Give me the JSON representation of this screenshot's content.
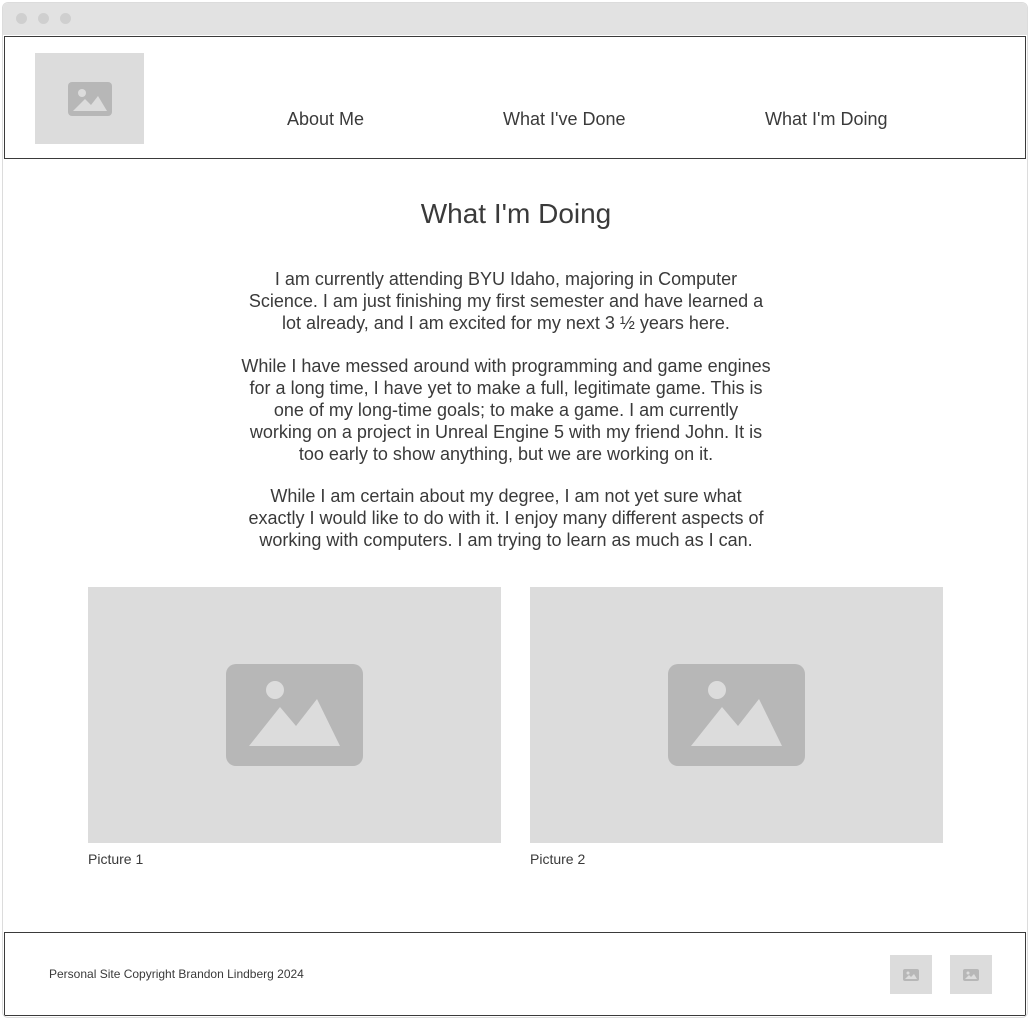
{
  "nav": {
    "items": [
      {
        "label": "About Me"
      },
      {
        "label": "What I've Done"
      },
      {
        "label": "What I'm Doing"
      }
    ]
  },
  "main": {
    "title": "What I'm Doing",
    "paragraphs": [
      "I am currently attending BYU Idaho, majoring in Computer Science. I am just finishing my first semester and have learned a lot already, and I am excited for my next 3 ½ years here.",
      "While I have messed around with programming and game engines for a long time, I have yet to make a full, legitimate game. This is one of my long-time goals; to make a game. I am currently working on a project in Unreal Engine 5 with my friend John. It is too early to show anything, but we are working on it.",
      "While I am certain about my degree, I am not yet sure what exactly I would like to do with it. I enjoy many different aspects of working with computers. I am trying to learn as much as I can."
    ],
    "pictures": [
      {
        "caption": "Picture 1"
      },
      {
        "caption": "Picture 2"
      }
    ]
  },
  "footer": {
    "copyright": "Personal Site Copyright Brandon Lindberg 2024"
  },
  "colors": {
    "placeholder_bg": "#dcdcdc",
    "placeholder_icon": "#b7b7b7",
    "text": "#3a3a3a"
  },
  "icons": {
    "logo": "image-placeholder-icon",
    "pictures": "image-placeholder-icon",
    "social": "image-placeholder-icon"
  }
}
